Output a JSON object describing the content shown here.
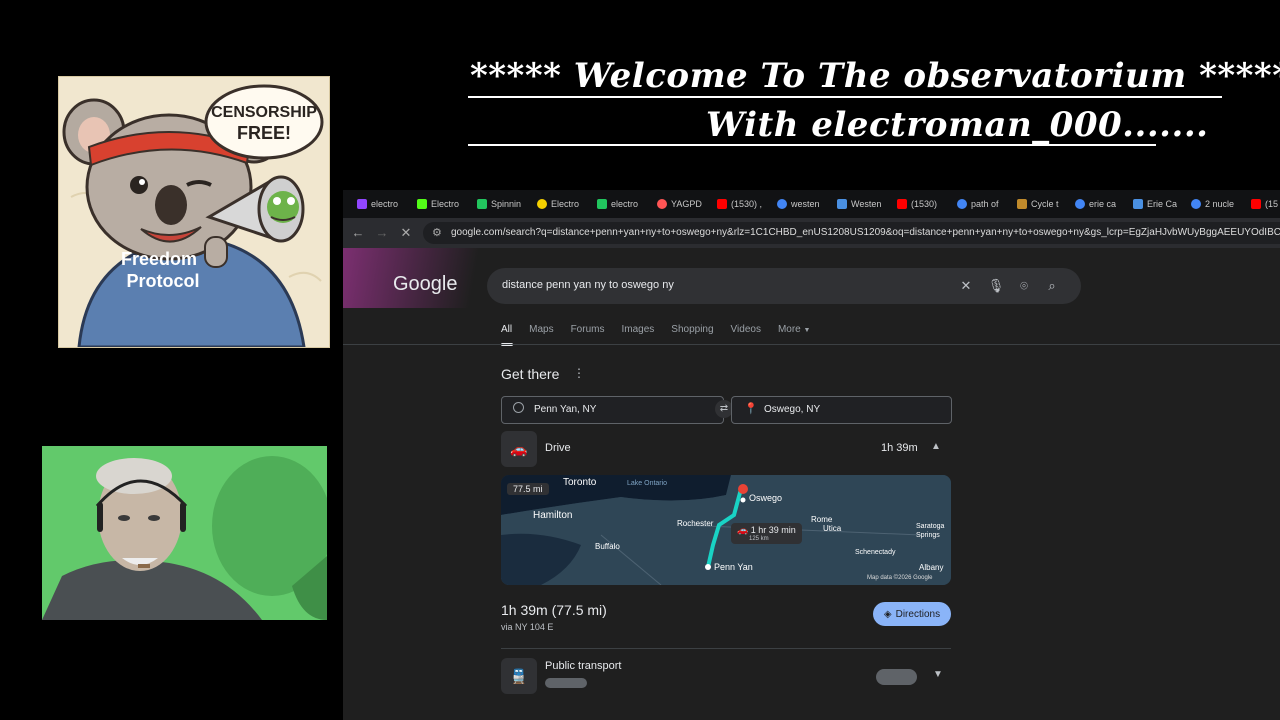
{
  "overlay": {
    "title_line1": "***** Welcome To The observatorium *****",
    "title_line2": "With electroman_000......."
  },
  "poster": {
    "speech_text": "CENSORSHIP FREE!",
    "hoodie_text": "Freedom Protocol"
  },
  "browser": {
    "tabs": [
      {
        "label": "electro",
        "color": "#9146ff"
      },
      {
        "label": "Electro",
        "color": "#53fc18"
      },
      {
        "label": "Spinnin",
        "color": "#22c55e"
      },
      {
        "label": "Electro",
        "color": "#f5d000"
      },
      {
        "label": "electro",
        "color": "#21c55e"
      },
      {
        "label": "YAGPD",
        "color": "#ff5555"
      },
      {
        "label": "(1530) ,",
        "color": "#ff0000"
      },
      {
        "label": "westen",
        "color": "#4285f4"
      },
      {
        "label": "Westen",
        "color": "#4a90e2"
      },
      {
        "label": "(1530)",
        "color": "#ff0000"
      },
      {
        "label": "path of",
        "color": "#4285f4"
      },
      {
        "label": "Cycle t",
        "color": "#c08a2b"
      },
      {
        "label": "erie ca",
        "color": "#4285f4"
      },
      {
        "label": "Erie Ca",
        "color": "#4a90e2"
      },
      {
        "label": "2 nucle",
        "color": "#4285f4"
      },
      {
        "label": "(15",
        "color": "#ff0000"
      }
    ],
    "url": "google.com/search?q=distance+penn+yan+ny+to+oswego+ny&rlz=1C1CHBD_enUS1208US1209&oq=distance+penn+yan+ny+to+oswego+ny&gs_lcrp=EgZjaHJvbWUyBggAEEUYOdIBCjIwMDU"
  },
  "google": {
    "logo": "Google",
    "query": "distance penn yan ny to oswego ny",
    "tabs": [
      "All",
      "Maps",
      "Forums",
      "Images",
      "Shopping",
      "Videos",
      "More"
    ],
    "get_there": {
      "heading": "Get there",
      "origin": "Penn Yan, NY",
      "destination": "Oswego, NY",
      "mode": "Drive",
      "mode_time": "1h 39m",
      "summary": "1h 39m (77.5 mi)",
      "via": "via NY 104 E",
      "directions_label": "Directions",
      "public_transport": "Public transport"
    },
    "map": {
      "distance_chip": "77.5 mi",
      "route_time": "1 hr 39 min",
      "route_km": "125 km",
      "credit": "Map data ©2026 Google",
      "places": [
        "Toronto",
        "Lake Ontario",
        "Hamilton",
        "Buffalo",
        "Rochester",
        "Oswego",
        "Rome",
        "Utica",
        "Saratoga Springs",
        "Schenectady",
        "Albany",
        "Penn Yan"
      ]
    }
  }
}
